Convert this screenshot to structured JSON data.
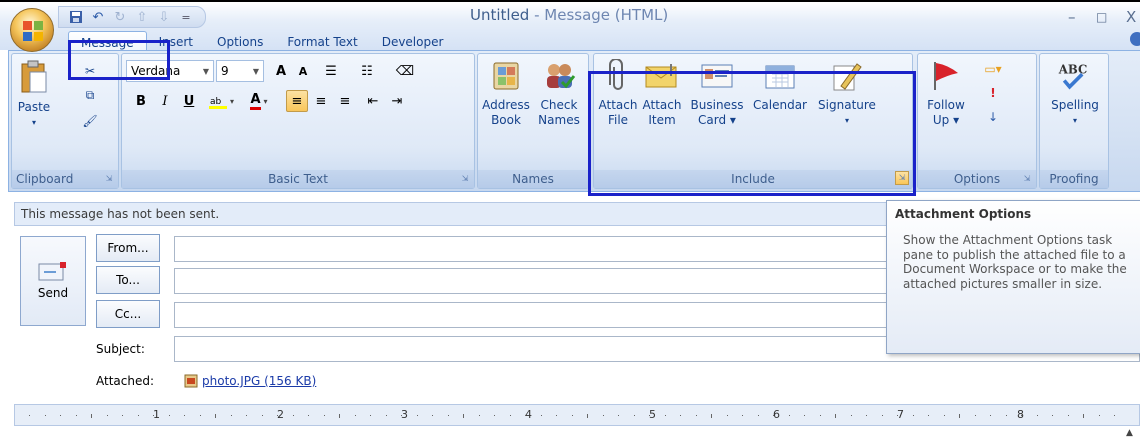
{
  "window": {
    "title": "Untitled",
    "app_suffix": " - Message (HTML)",
    "minimize": "–",
    "maximize": "□",
    "close": "X"
  },
  "qat": {
    "save_icon": "save-icon",
    "undo_icon": "undo-icon",
    "redo_icon": "redo-icon",
    "prev_icon": "up-arrow-icon",
    "next_icon": "down-arrow-icon",
    "customize": "="
  },
  "tabs": [
    "Message",
    "Insert",
    "Options",
    "Format Text",
    "Developer"
  ],
  "active_tab": "Message",
  "ribbon": {
    "clipboard": {
      "label": "Clipboard",
      "paste": "Paste"
    },
    "basic_text": {
      "label": "Basic Text",
      "font": "Verdana",
      "size": "9",
      "grow_font": "A",
      "shrink_font": "A",
      "bold": "B",
      "italic": "I",
      "underline": "U",
      "font_color": "A"
    },
    "names": {
      "label": "Names",
      "address_book_1": "Address",
      "address_book_2": "Book",
      "check_names_1": "Check",
      "check_names_2": "Names"
    },
    "include": {
      "label": "Include",
      "attach_file_1": "Attach",
      "attach_file_2": "File",
      "attach_item_1": "Attach",
      "attach_item_2": "Item",
      "business_card_1": "Business",
      "business_card_2": "Card ▾",
      "calendar": "Calendar",
      "signature": "Signature",
      "signature_arrow": "▾"
    },
    "options": {
      "label": "Options",
      "follow_up_1": "Follow",
      "follow_up_2": "Up ▾"
    },
    "proofing": {
      "label": "Proofing",
      "spelling": "Spelling",
      "spelling_arrow": "▾",
      "abc": "ABC"
    }
  },
  "infobar": "This message has not been sent.",
  "compose": {
    "send": "Send",
    "from": "From...",
    "to": "To...",
    "cc": "Cc...",
    "subject_label": "Subject:",
    "attached_label": "Attached:",
    "attachment": "photo.JPG (156 KB)"
  },
  "ruler": {
    "numbers": [
      "1",
      "2",
      "3",
      "4",
      "5",
      "6",
      "7",
      "8"
    ]
  },
  "tooltip": {
    "title": "Attachment Options",
    "body": "Show the Attachment Options task pane to publish the attached file to a Document Workspace or to make the attached pictures smaller in size."
  }
}
